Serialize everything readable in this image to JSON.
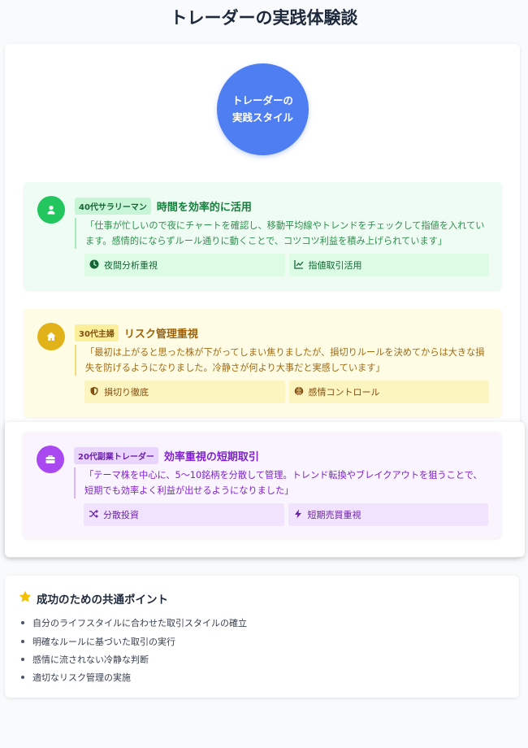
{
  "page": {
    "title": "トレーダーの実践体験談"
  },
  "hero": {
    "line1": "トレーダーの",
    "line2": "実践スタイル"
  },
  "stories": [
    {
      "badge": "40代サラリーマン",
      "title": "時間を効率的に活用",
      "icon": "user-icon",
      "color": "#22c55e",
      "quote": "「仕事が忙しいので夜にチャートを確認し、移動平均線やトレンドをチェックして指値を入れています。感情的にならずルール通りに動くことで、コツコツ利益を積み上げられています」",
      "tags": [
        {
          "label": "夜間分析重視",
          "icon": "clock-icon"
        },
        {
          "label": "指値取引活用",
          "icon": "chart-line-icon"
        }
      ]
    },
    {
      "badge": "30代主婦",
      "title": "リスク管理重視",
      "icon": "home-icon",
      "color": "#e1b21a",
      "quote": "「最初は上がると思った株が下がってしまい焦りましたが、損切りルールを決めてからは大きな損失を防げるようになりました。冷静さが何より大事だと実感しています」",
      "tags": [
        {
          "label": "損切り徹底",
          "icon": "shield-icon"
        },
        {
          "label": "感情コントロール",
          "icon": "brain-icon"
        }
      ]
    },
    {
      "badge": "20代副業トレーダー",
      "title": "効率重視の短期取引",
      "icon": "briefcase-icon",
      "color": "#a948f0",
      "quote": "「テーマ株を中心に、5〜10銘柄を分散して管理。トレンド転換やブレイクアウトを狙うことで、短期でも効率よく利益が出せるようになりました」",
      "tags": [
        {
          "label": "分散投資",
          "icon": "shuffle-icon"
        },
        {
          "label": "短期売買重視",
          "icon": "bolt-icon"
        }
      ]
    }
  ],
  "points": {
    "title": "成功のための共通ポイント",
    "icon": "star-icon",
    "items": [
      "自分のライフスタイルに合わせた取引スタイルの確立",
      "明確なルールに基づいた取引の実行",
      "感情に流されない冷静な判断",
      "適切なリスク管理の実施"
    ]
  }
}
